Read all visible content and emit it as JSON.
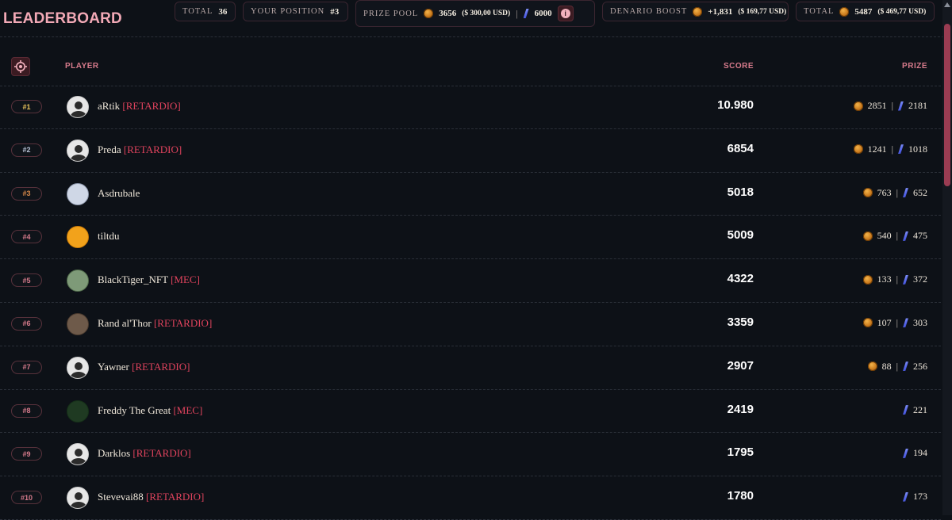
{
  "title": "LEADERBOARD",
  "stats": {
    "total_label": "TOTAL",
    "total_value": "36",
    "position_label": "YOUR POSITION",
    "position_value": "#3",
    "prize_pool_label": "PRIZE POOL",
    "prize_pool_coins": "3656",
    "prize_pool_usd": "($ 300,00 USD)",
    "prize_pool_crystals": "6000",
    "boost_label": "DENARIO BOOST",
    "boost_value": "+1,831",
    "boost_usd": "($ 169,77 USD)",
    "grand_total_label": "TOTAL",
    "grand_total_value": "5487",
    "grand_total_usd": "($ 469,77 USD)"
  },
  "table": {
    "col_player": "PLAYER",
    "col_score": "SCORE",
    "col_prize": "PRIZE"
  },
  "rows": [
    {
      "rank": "#1",
      "rank_color": "#e8c25a",
      "name": "aRtik",
      "team": "[RETARDIO]",
      "score": "10.980",
      "coins": "2851",
      "crystals": "2181",
      "avatar": "default"
    },
    {
      "rank": "#2",
      "rank_color": "#b9c3d6",
      "name": "Preda",
      "team": "[RETARDIO]",
      "score": "6854",
      "coins": "1241",
      "crystals": "1018",
      "avatar": "default"
    },
    {
      "rank": "#3",
      "rank_color": "#d8894a",
      "name": "Asdrubale",
      "team": "",
      "score": "5018",
      "coins": "763",
      "crystals": "652",
      "avatar": "pixel-character"
    },
    {
      "rank": "#4",
      "rank_color": "#d77b8c",
      "name": "tiltdu",
      "team": "",
      "score": "5009",
      "coins": "540",
      "crystals": "475",
      "avatar": "orange-character"
    },
    {
      "rank": "#5",
      "rank_color": "#d77b8c",
      "name": "BlackTiger_NFT",
      "team": "[MEC]",
      "score": "4322",
      "coins": "133",
      "crystals": "372",
      "avatar": "green-character"
    },
    {
      "rank": "#6",
      "rank_color": "#d77b8c",
      "name": "Rand al'Thor",
      "team": "[RETARDIO]",
      "score": "3359",
      "coins": "107",
      "crystals": "303",
      "avatar": "brown-character"
    },
    {
      "rank": "#7",
      "rank_color": "#d77b8c",
      "name": "Yawner",
      "team": "[RETARDIO]",
      "score": "2907",
      "coins": "88",
      "crystals": "256",
      "avatar": "default"
    },
    {
      "rank": "#8",
      "rank_color": "#d77b8c",
      "name": "Freddy The Great",
      "team": "[MEC]",
      "score": "2419",
      "coins": "",
      "crystals": "221",
      "avatar": "dark-character"
    },
    {
      "rank": "#9",
      "rank_color": "#d77b8c",
      "name": "Darklos",
      "team": "[RETARDIO]",
      "score": "1795",
      "coins": "",
      "crystals": "194",
      "avatar": "default"
    },
    {
      "rank": "#10",
      "rank_color": "#d77b8c",
      "name": "Stevevai88",
      "team": "[RETARDIO]",
      "score": "1780",
      "coins": "",
      "crystals": "173",
      "avatar": "default"
    }
  ],
  "colors": {
    "background": "#0d1117",
    "accent": "#f2a9b6",
    "team_tag": "#e0435d",
    "header_label": "#d77b8c"
  },
  "icons": {
    "coin": "gold-coin-icon",
    "crystal": "blue-crystal-icon",
    "info": "info-icon",
    "target": "crosshair-target-icon",
    "avatar_default": "user-avatar-icon"
  }
}
